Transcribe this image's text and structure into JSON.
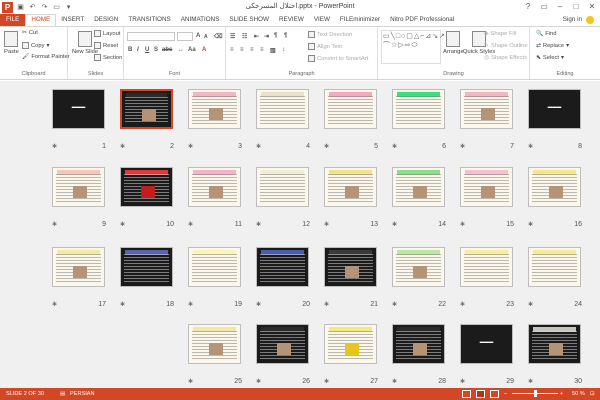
{
  "title": "احتلال المسرحکی.pptx - PowerPoint",
  "qat": {
    "logo": "P",
    "icons": [
      "save-icon",
      "undo-icon",
      "redo-icon",
      "presentation-icon",
      "customize-icon"
    ]
  },
  "window_controls": [
    "?",
    "▭",
    "–",
    "□",
    "✕"
  ],
  "tabs": [
    "FILE",
    "HOME",
    "INSERT",
    "DESIGN",
    "TRANSITIONS",
    "ANIMATIONS",
    "SLIDE SHOW",
    "REVIEW",
    "VIEW",
    "FILEminimizer",
    "Nitro PDF Professional"
  ],
  "signin": "Sign in",
  "ribbon": {
    "clipboard": {
      "label": "Clipboard",
      "paste": "Paste",
      "cut": "Cut",
      "copy": "Copy",
      "format_painter": "Format Painter"
    },
    "slides": {
      "label": "Slides",
      "new_slide": "New Slide",
      "layout": "Layout",
      "reset": "Reset",
      "section": "Section"
    },
    "font": {
      "label": "Font",
      "bold": "B",
      "italic": "I",
      "underline": "U",
      "shadow": "S",
      "strike": "abc",
      "aa": "Aa",
      "grow": "A",
      "shrink": "A"
    },
    "paragraph": {
      "label": "Paragraph",
      "text_direction": "Text Direction",
      "align_text": "Align Text",
      "convert": "Convert to SmartArt"
    },
    "drawing": {
      "label": "Drawing",
      "arrange": "Arrange",
      "quick_styles": "Quick Styles",
      "shape_fill": "Shape Fill",
      "shape_outline": "Shape Outline",
      "shape_effects": "Shape Effects"
    },
    "editing": {
      "label": "Editing",
      "find": "Find",
      "replace": "Replace",
      "select": "Select"
    }
  },
  "slides": [
    {
      "n": "8",
      "theme": "black-title",
      "band": "#0f0f0f"
    },
    {
      "n": "7",
      "theme": "pink-question",
      "band": "#f4b6c4"
    },
    {
      "n": "6",
      "theme": "green-red",
      "band": "#3be07e"
    },
    {
      "n": "5",
      "theme": "pink-text",
      "band": "#f7a8c0"
    },
    {
      "n": "4",
      "theme": "beige-text",
      "band": "#e9e2c9"
    },
    {
      "n": "3",
      "theme": "pink-question",
      "band": "#f4b6c4"
    },
    {
      "n": "2",
      "theme": "dark-photo",
      "band": "#2a2a2a"
    },
    {
      "n": "1",
      "theme": "dark-title",
      "band": "#1a1a1a"
    },
    {
      "n": "16",
      "theme": "yellow-photo",
      "band": "#f5e88c"
    },
    {
      "n": "15",
      "theme": "pink-photo",
      "band": "#f4c1cd"
    },
    {
      "n": "14",
      "theme": "green-photo",
      "band": "#8fdc8a"
    },
    {
      "n": "13",
      "theme": "yellow-photo",
      "band": "#f1e38b"
    },
    {
      "n": "12",
      "theme": "beige-text",
      "band": "#f2ecd3"
    },
    {
      "n": "11",
      "theme": "pink-photo",
      "band": "#f5b3c7"
    },
    {
      "n": "10",
      "theme": "red-art",
      "band": "#e23a3a"
    },
    {
      "n": "9",
      "theme": "pink-photo",
      "band": "#f6c7b5"
    },
    {
      "n": "24",
      "theme": "yellow-text",
      "band": "#f4ea9a"
    },
    {
      "n": "23",
      "theme": "yellow-text",
      "band": "#f7ee9e"
    },
    {
      "n": "22",
      "theme": "green-photo",
      "band": "#bde6a2"
    },
    {
      "n": "21",
      "theme": "dark-photo",
      "band": "#3a3a3a"
    },
    {
      "n": "20",
      "theme": "blue-text",
      "band": "#4b5fa8"
    },
    {
      "n": "19",
      "theme": "yellow-text",
      "band": "#fbf4b8"
    },
    {
      "n": "18",
      "theme": "blue-text",
      "band": "#5866a8"
    },
    {
      "n": "17",
      "theme": "yellow-photo",
      "band": "#f3e9a7"
    },
    {
      "n": "30",
      "theme": "laptop",
      "band": "#c8c4be"
    },
    {
      "n": "29",
      "theme": "black-end",
      "band": "#0c0c0c"
    },
    {
      "n": "28",
      "theme": "collage",
      "band": "#2a2a2a"
    },
    {
      "n": "27",
      "theme": "flowers",
      "band": "#f3ea7a"
    },
    {
      "n": "26",
      "theme": "dark-photo",
      "band": "#2a2a2a"
    },
    {
      "n": "25",
      "theme": "yellow-photo",
      "band": "#f4e7a6"
    }
  ],
  "status": {
    "slide": "SLIDE 2 OF 30",
    "language": "PERSIAN",
    "zoom": "50 %",
    "zoom_level": 0.5
  }
}
